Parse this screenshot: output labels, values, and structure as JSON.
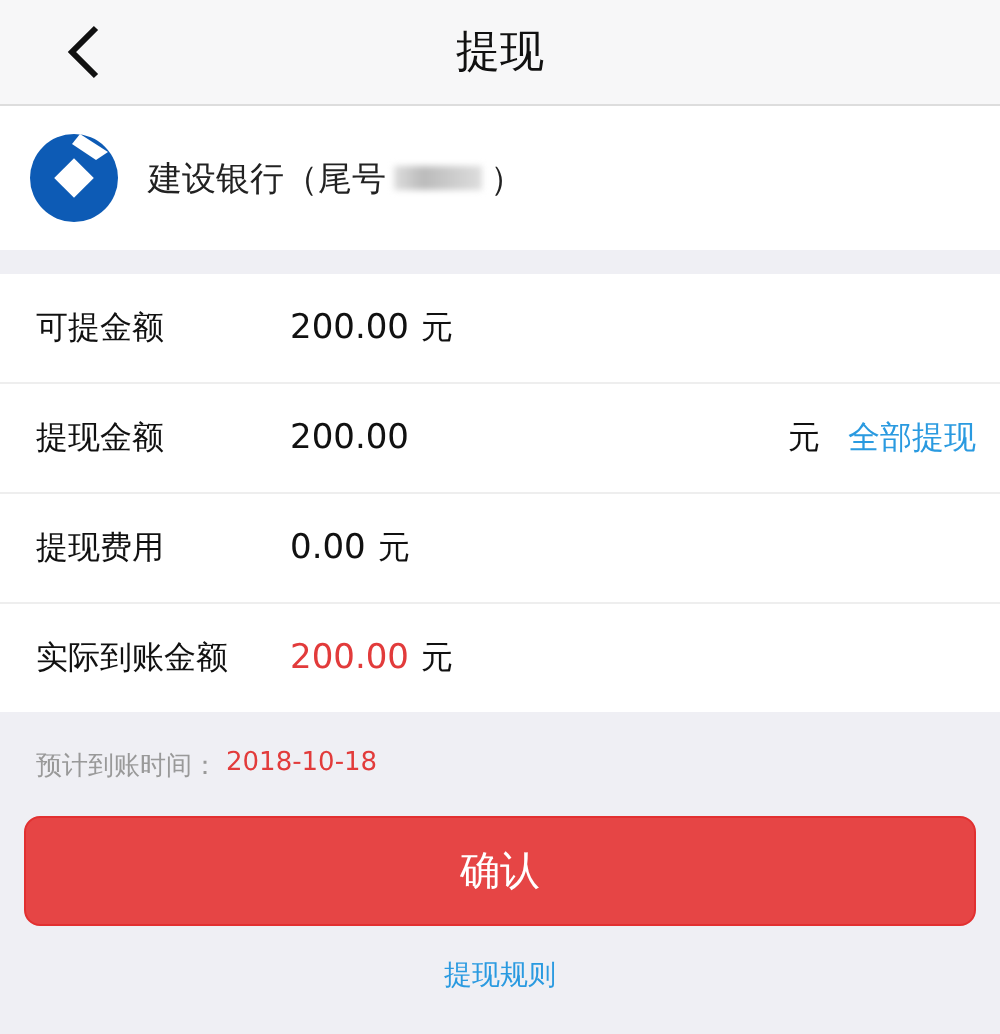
{
  "header": {
    "title": "提现"
  },
  "bank": {
    "name": "建设银行（尾号",
    "close": "）"
  },
  "rows": [
    {
      "kind": "text",
      "label": "可提金额",
      "value": "200.00",
      "unit": "元"
    },
    {
      "kind": "input",
      "label": "提现金额",
      "value": "200.00",
      "unit": "元",
      "action": "全部提现"
    },
    {
      "kind": "text",
      "label": "提现费用",
      "value": "0.00",
      "unit": "元"
    },
    {
      "kind": "highlight",
      "label": "实际到账金额",
      "value": "200.00",
      "unit": "元"
    }
  ],
  "arrival": {
    "label": "预计到账时间：",
    "date": "2018-10-18"
  },
  "confirm": "确认",
  "rules_link": "提现规则"
}
